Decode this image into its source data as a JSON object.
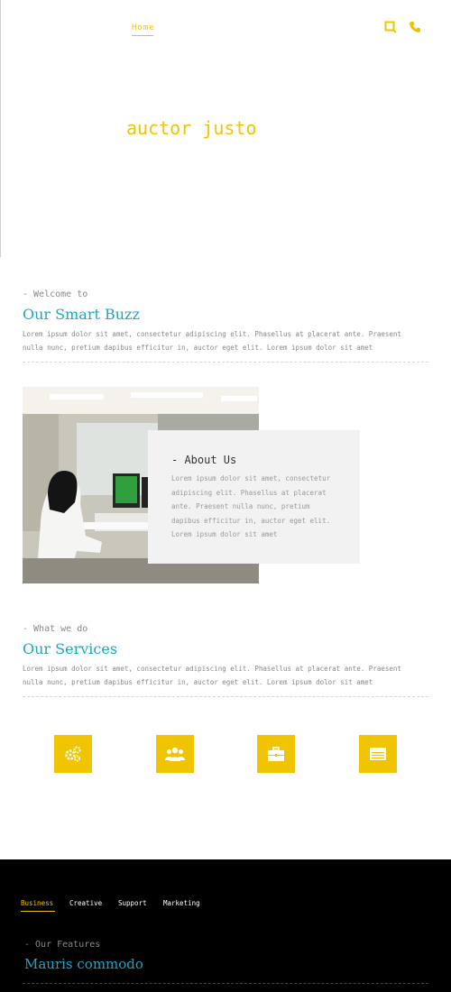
{
  "nav": {
    "home_label": "Home"
  },
  "hero": {
    "title": "auctor justo"
  },
  "welcome": {
    "kicker": "- Welcome to",
    "title": "Our Smart Buzz",
    "text": "Lorem ipsum dolor sit amet, consectetur adipiscing elit. Phasellus at placerat ante. Praesent nulla nunc, pretium dapibus efficitur in, auctor eget elit. Lorem ipsum dolor sit amet"
  },
  "about": {
    "title": "- About Us",
    "text": "Lorem ipsum dolor sit amet, consectetur adipiscing elit. Phasellus at placerat ante. Praesent nulla nunc, pretium dapibus efficitur in, auctor eget elit. Lorem ipsum dolor sit amet"
  },
  "services": {
    "kicker": "- What we do",
    "title": "Our Services",
    "text": "Lorem ipsum dolor sit amet, consectetur adipiscing elit. Phasellus at placerat ante. Praesent nulla nunc, pretium dapibus efficitur in, auctor eget elit. Lorem ipsum dolor sit amet",
    "icons": [
      "gears-icon",
      "users-icon",
      "briefcase-icon",
      "list-icon"
    ]
  },
  "footer": {
    "tabs": [
      "Business",
      "Creative",
      "Support",
      "Marketing"
    ],
    "kicker": "- Our Features",
    "title": "Mauris commodo"
  },
  "colors": {
    "accent": "#f0c400",
    "heading": "#1aa7c6",
    "footer_bg": "#000000"
  }
}
